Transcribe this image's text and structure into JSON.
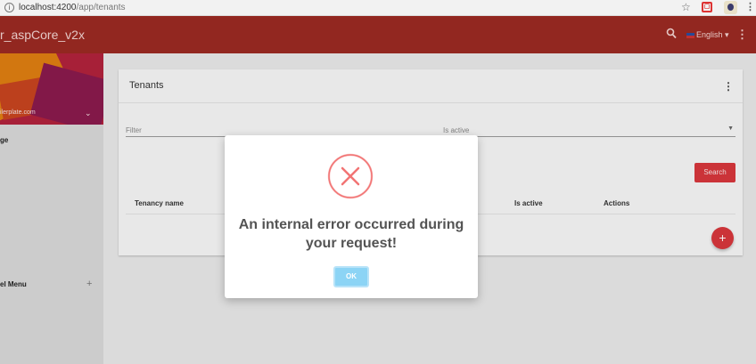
{
  "browser": {
    "url_host": "localhost:4200",
    "url_path": "/app/tenants"
  },
  "header": {
    "app_title": "r_aspCore_v2x",
    "language": "English",
    "language_caret": "▾"
  },
  "sidebar": {
    "email": "ilerplate.com",
    "items": [
      {
        "label": "ge"
      },
      {
        "label": "el Menu"
      }
    ]
  },
  "card": {
    "title": "Tenants",
    "filter_placeholder": "Filter",
    "isactive_label": "Is active",
    "search_label": "Search",
    "columns": [
      "Tenancy name",
      "Is active",
      "Actions"
    ]
  },
  "modal": {
    "message": "An internal error occurred during your request!",
    "ok_label": "OK"
  },
  "colors": {
    "header": "#9c2a23",
    "accent": "#d8373c",
    "error_icon": "#f27474",
    "ok_button": "#8cd4f5"
  }
}
